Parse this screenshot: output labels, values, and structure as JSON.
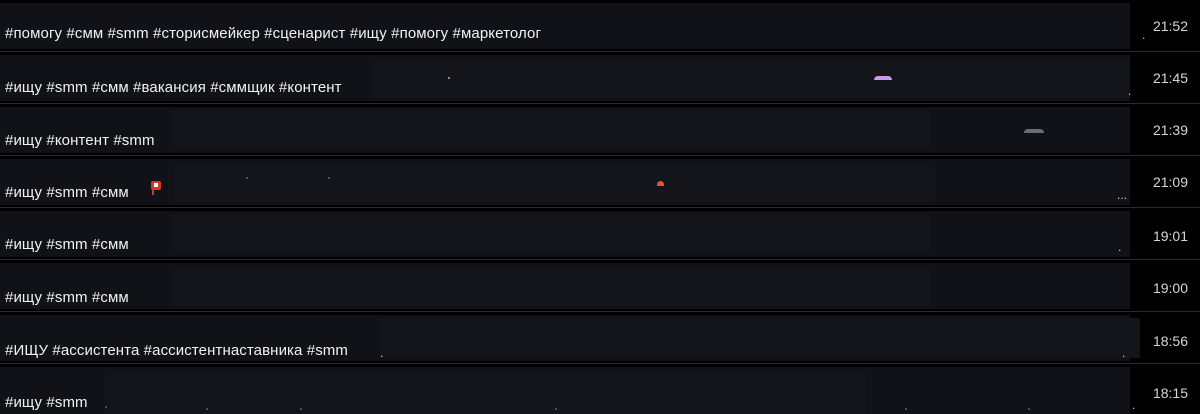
{
  "messages": [
    {
      "text": "#помогу #смм #smm #сторисмейкер #сценарист #ищу #помогу #маркетолог",
      "time": "21:52"
    },
    {
      "text": "#ищу #smm #смм #вакансия #сммщик #контент",
      "time": "21:45"
    },
    {
      "text": "#ищу #контент #smm",
      "time": "21:39"
    },
    {
      "text": "#ищу #smm #смм",
      "time": "21:09"
    },
    {
      "text": "#ищу #smm #смм",
      "time": "19:01"
    },
    {
      "text": "#ищу #smm #смм",
      "time": "19:00"
    },
    {
      "text": "#ИЩУ #ассистента #ассистентнаставника #smm",
      "time": "18:56"
    },
    {
      "text": "#ищу  #smm",
      "time": "18:15"
    }
  ],
  "ellipsis": "...",
  "icons": {
    "flag": "red-flag-icon"
  },
  "colors": {
    "background": "#000000",
    "row": "#101218",
    "divider": "#2a2b31",
    "text": "#f2f2f2",
    "time": "#d6d6d6"
  }
}
